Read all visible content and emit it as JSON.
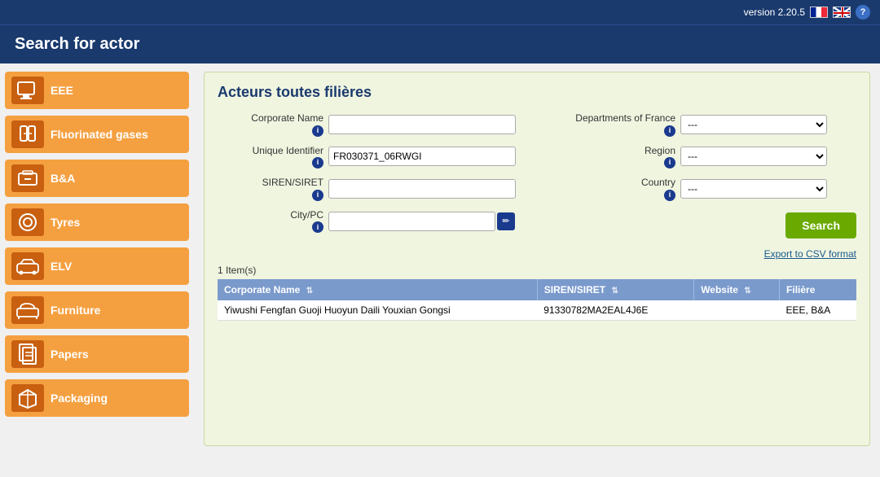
{
  "topbar": {
    "version": "version 2.20.5",
    "help_label": "?"
  },
  "header": {
    "title": "Search for actor"
  },
  "sidebar": {
    "items": [
      {
        "id": "eee",
        "label": "EEE",
        "icon": "🖥"
      },
      {
        "id": "fluorinated",
        "label": "Fluorinated gases",
        "icon": "🔧"
      },
      {
        "id": "ba",
        "label": "B&A",
        "icon": "🔋"
      },
      {
        "id": "tyres",
        "label": "Tyres",
        "icon": "⭕"
      },
      {
        "id": "elv",
        "label": "ELV",
        "icon": "🚗"
      },
      {
        "id": "furniture",
        "label": "Furniture",
        "icon": "🛋"
      },
      {
        "id": "papers",
        "label": "Papers",
        "icon": "📄"
      },
      {
        "id": "packaging",
        "label": "Packaging",
        "icon": "📦"
      }
    ]
  },
  "panel": {
    "title": "Acteurs toutes filières",
    "form": {
      "corporate_name_label": "Corporate Name",
      "unique_id_label": "Unique Identifier",
      "siren_label": "SIREN/SIRET",
      "city_label": "City/PC",
      "depts_france_label": "Departments of France",
      "region_label": "Region",
      "country_label": "Country",
      "corporate_name_value": "",
      "unique_id_value": "FR030371_06RWGI",
      "siren_value": "",
      "city_value": "",
      "depts_value": "---",
      "region_value": "---",
      "country_value": "---",
      "search_button": "Search",
      "export_link": "Export to CSV format",
      "dept_options": [
        "---"
      ],
      "region_options": [
        "---"
      ],
      "country_options": [
        "---"
      ]
    },
    "results": {
      "count_label": "1 Item(s)",
      "columns": [
        {
          "key": "corporate_name",
          "label": "Corporate Name"
        },
        {
          "key": "siren",
          "label": "SIREN/SIRET"
        },
        {
          "key": "website",
          "label": "Website"
        },
        {
          "key": "filiere",
          "label": "Filière"
        }
      ],
      "rows": [
        {
          "corporate_name": "Yiwushi Fengfan Guoji Huoyun Daili Youxian Gongsi",
          "siren": "91330782MA2EAL4J6E",
          "website": "",
          "filiere": "EEE, B&A"
        }
      ]
    }
  }
}
